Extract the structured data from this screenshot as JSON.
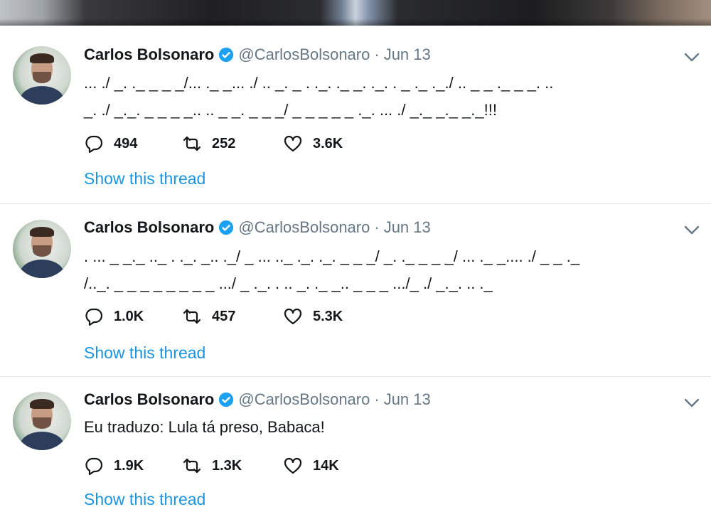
{
  "tweets": [
    {
      "author_name": "Carlos Bolsonaro",
      "handle": "@CarlosBolsonaro",
      "separator": "·",
      "date": "Jun 13",
      "text": "... ./ _. ._ _ _ _/... ._ _... ./ .. _. _ . ._. ._ _. ._. . _ ._ ._./ .. _ _ ._ _ _. ..\n_. ./ _._. _ _ _ _.. .. _ _. _ _ _/ _ _ _ _ _ ._. ... ./ _._ _._ _._!!!",
      "replies": "494",
      "retweets": "252",
      "likes": "3.6K",
      "show_thread": "Show this thread"
    },
    {
      "author_name": "Carlos Bolsonaro",
      "handle": "@CarlosBolsonaro",
      "separator": "·",
      "date": "Jun 13",
      "text": ". ... _ _._ .._ . ._. _.. ._/ _ ... .._ ._. ._. _ _ _/ _. ._ _ _ _/ ... ._ _.... ./ _ _ ._\n/.._. _ _ _ _ _ _ _ _ .../ _ ._. . .. _. ._ _.. _ _ _ .../_ ./ _._. .. ._",
      "replies": "1.0K",
      "retweets": "457",
      "likes": "5.3K",
      "show_thread": "Show this thread"
    },
    {
      "author_name": "Carlos Bolsonaro",
      "handle": "@CarlosBolsonaro",
      "separator": "·",
      "date": "Jun 13",
      "text": "Eu traduzo: Lula tá preso, Babaca!",
      "replies": "1.9K",
      "retweets": "1.3K",
      "likes": "14K",
      "show_thread": "Show this thread"
    }
  ],
  "colors": {
    "link": "#1b95e0",
    "verified": "#1da1f2",
    "secondary_text": "#657786",
    "divider": "#dfe6ec"
  },
  "icons": {
    "reply": "reply-icon",
    "retweet": "retweet-icon",
    "like": "heart-icon",
    "verified": "verified-badge-icon",
    "caret": "chevron-down-icon"
  }
}
